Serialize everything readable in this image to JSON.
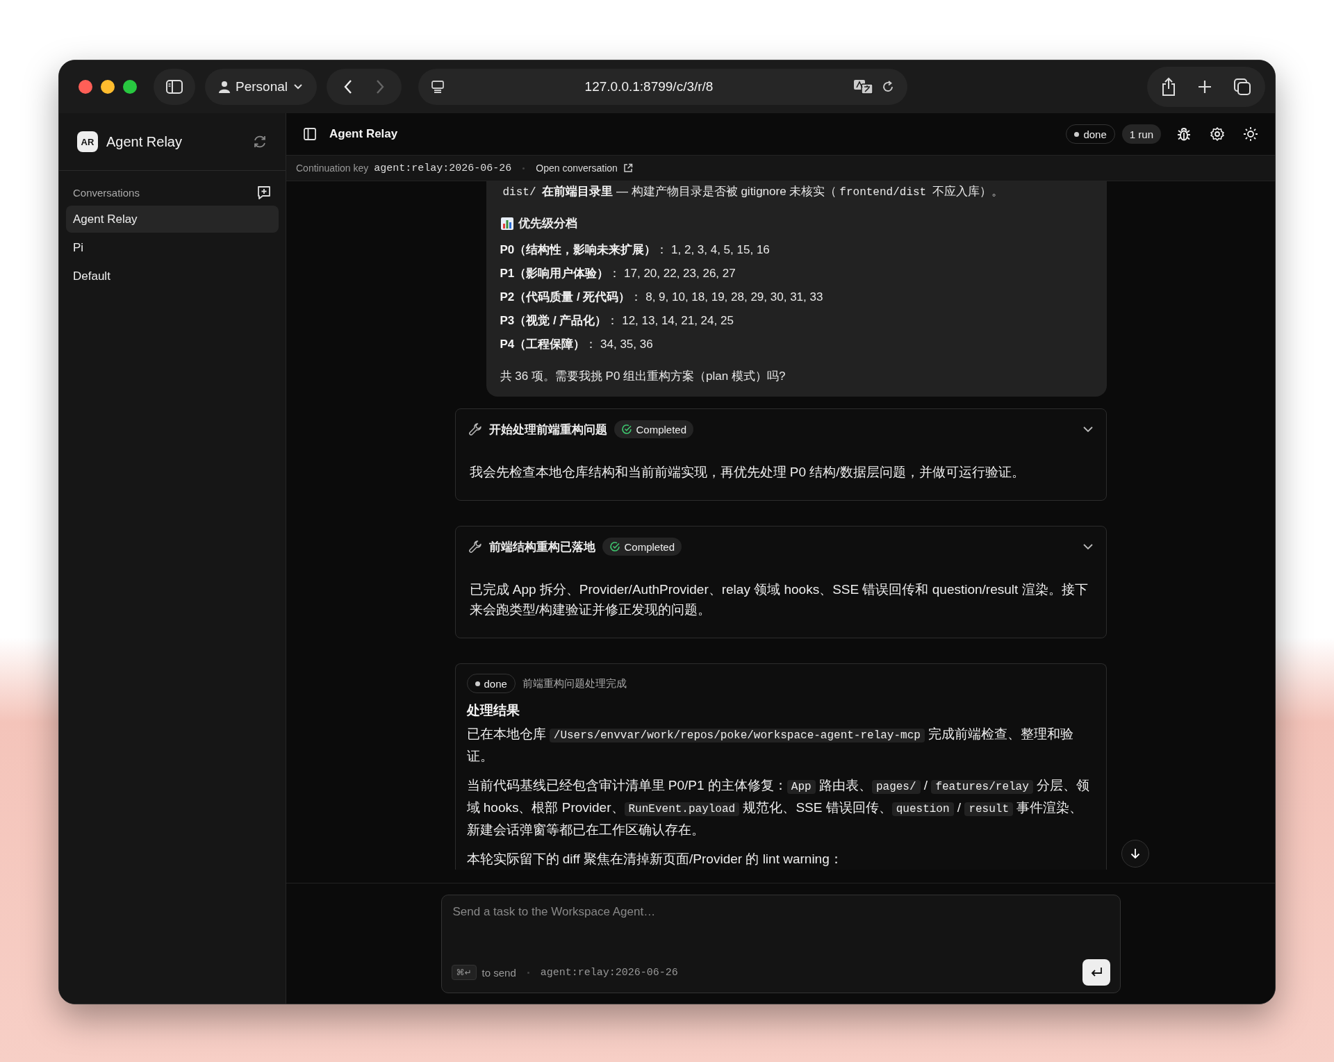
{
  "browser": {
    "profile": "Personal",
    "url": "127.0.0.1:8799/c/3/r/8",
    "nav": [
      {
        "kind": "back",
        "disabled": false
      },
      {
        "kind": "forward",
        "disabled": true
      }
    ]
  },
  "sidebar": {
    "app_initials": "AR",
    "app_name": "Agent Relay",
    "section_label": "Conversations",
    "items": [
      {
        "label": "Agent Relay",
        "selected": true
      },
      {
        "label": "Pi",
        "selected": false
      },
      {
        "label": "Default",
        "selected": false
      }
    ]
  },
  "header": {
    "title": "Agent Relay",
    "status": "done",
    "runs": "1 run"
  },
  "continuation": {
    "label": "Continuation key",
    "key": "agent:relay:2026-06-26",
    "link": "Open conversation"
  },
  "messages": [
    {
      "kind": "assistant",
      "blocks": [
        {
          "kind": "paragraph",
          "segments": [
            {
              "kind": "code",
              "text": "dist/"
            },
            {
              "kind": "strong",
              "text": " 在前端目录里"
            },
            {
              "kind": "text",
              "text": " — 构建产物目录是否被 gitignore 未核实（"
            },
            {
              "kind": "code",
              "text": "frontend/dist"
            },
            {
              "kind": "text",
              "text": " 不应入库）。"
            }
          ]
        },
        {
          "kind": "heading",
          "text": "优先级分档"
        },
        {
          "kind": "line",
          "segments": [
            {
              "kind": "strong",
              "text": "P0（结构性，影响未来扩展）"
            },
            {
              "kind": "text",
              "text": "： 1, 2, 3, 4, 5, 15, 16"
            }
          ]
        },
        {
          "kind": "line",
          "segments": [
            {
              "kind": "strong",
              "text": "P1（影响用户体验）"
            },
            {
              "kind": "text",
              "text": "： 17, 20, 22, 23, 26, 27"
            }
          ]
        },
        {
          "kind": "line",
          "segments": [
            {
              "kind": "strong",
              "text": "P2（代码质量 / 死代码）"
            },
            {
              "kind": "text",
              "text": "： 8, 9, 10, 18, 19, 28, 29, 30, 31, 33"
            }
          ]
        },
        {
          "kind": "line",
          "segments": [
            {
              "kind": "strong",
              "text": "P3（视觉 / 产品化）"
            },
            {
              "kind": "text",
              "text": "： 12, 13, 14, 21, 24, 25"
            }
          ]
        },
        {
          "kind": "line",
          "segments": [
            {
              "kind": "strong",
              "text": "P4（工程保障）"
            },
            {
              "kind": "text",
              "text": "： 34, 35, 36"
            }
          ]
        },
        {
          "kind": "paragraph",
          "segments": [
            {
              "kind": "text",
              "text": "共 36 项。需要我挑 P0 组出重构方案（plan 模式）吗?"
            }
          ]
        }
      ]
    },
    {
      "kind": "tool",
      "title": "开始处理前端重构问题",
      "status": "Completed",
      "body": "我会先检查本地仓库结构和当前前端实现，再优先处理 P0 结构/数据层问题，并做可运行验证。"
    },
    {
      "kind": "tool",
      "title": "前端结构重构已落地",
      "status": "Completed",
      "body": "已完成 App 拆分、Provider/AuthProvider、relay 领域 hooks、SSE 错误回传和 question/result 渲染。接下来会跑类型/构建验证并修正发现的问题。"
    },
    {
      "kind": "result",
      "status": "done",
      "summary": "前端重构问题处理完成",
      "title": "处理结果",
      "paragraphs": [
        [
          {
            "kind": "text",
            "text": "已在本地仓库 "
          },
          {
            "kind": "code",
            "text": "/Users/envvar/work/repos/poke/workspace-agent-relay-mcp"
          },
          {
            "kind": "text",
            "text": " 完成前端检查、整理和验证。"
          }
        ],
        [
          {
            "kind": "text",
            "text": "当前代码基线已经包含审计清单里 P0/P1 的主体修复："
          },
          {
            "kind": "code",
            "text": "App"
          },
          {
            "kind": "text",
            "text": " 路由表、"
          },
          {
            "kind": "code",
            "text": "pages/"
          },
          {
            "kind": "text",
            "text": " / "
          },
          {
            "kind": "code",
            "text": "features/relay"
          },
          {
            "kind": "text",
            "text": " 分层、领域 hooks、根部 Provider、"
          },
          {
            "kind": "code",
            "text": "RunEvent.payload"
          },
          {
            "kind": "text",
            "text": " 规范化、SSE 错误回传、"
          },
          {
            "kind": "code",
            "text": "question"
          },
          {
            "kind": "text",
            "text": " / "
          },
          {
            "kind": "code",
            "text": "result"
          },
          {
            "kind": "text",
            "text": " 事件渲染、新建会话弹窗等都已在工作区确认存在。"
          }
        ],
        [
          {
            "kind": "text",
            "text": "本轮实际留下的 diff 聚焦在清掉新页面/Provider 的 lint warning："
          }
        ]
      ]
    }
  ],
  "composer": {
    "placeholder": "Send a task to the Workspace Agent…",
    "shortcut": "⌘↵",
    "hint": "to send",
    "key": "agent:relay:2026-06-26"
  }
}
